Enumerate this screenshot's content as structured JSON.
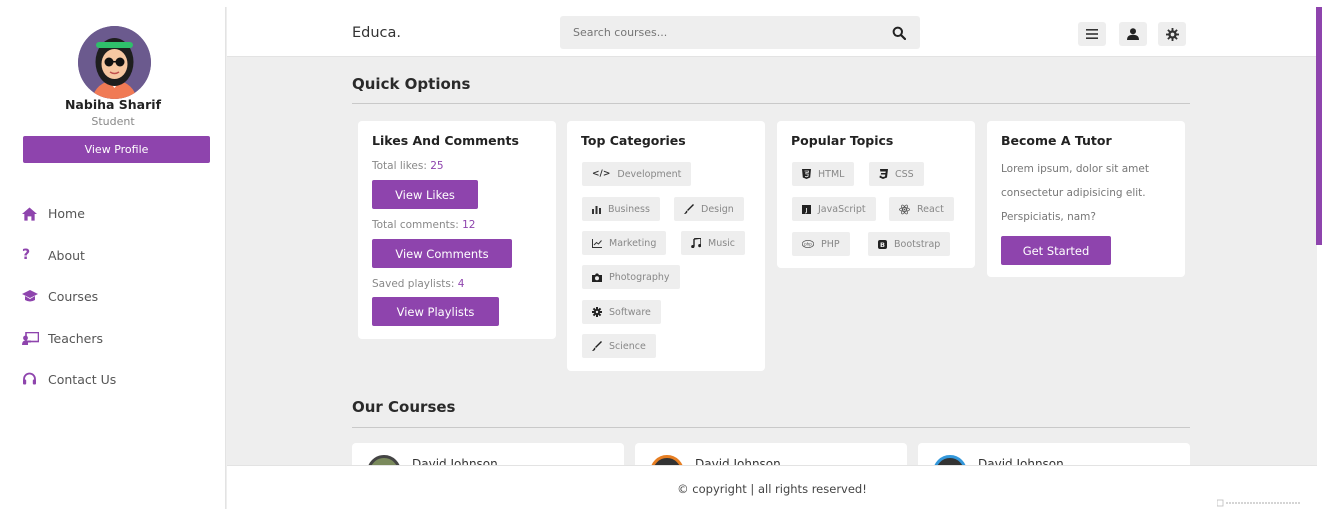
{
  "sidebar": {
    "user_name": "Nabiha Sharif",
    "user_role": "Student",
    "profile_button": "View Profile",
    "nav": [
      {
        "label": "Home",
        "icon": "home-icon"
      },
      {
        "label": "About",
        "icon": "question-icon"
      },
      {
        "label": "Courses",
        "icon": "graduation-cap-icon"
      },
      {
        "label": "Teachers",
        "icon": "chalkboard-teacher-icon"
      },
      {
        "label": "Contact Us",
        "icon": "headset-icon"
      }
    ]
  },
  "header": {
    "logo": "Educa.",
    "search_placeholder": "Search courses...",
    "icons": [
      "menu-icon",
      "user-icon",
      "settings-gear-icon"
    ]
  },
  "quick_options": {
    "title": "Quick Options",
    "likes_card": {
      "title": "Likes And Comments",
      "likes_label": "Total likes: ",
      "likes_value": "25",
      "likes_button": "View Likes",
      "comments_label": "Total comments: ",
      "comments_value": "12",
      "comments_button": "View Comments",
      "playlists_label": "Saved playlists: ",
      "playlists_value": "4",
      "playlists_button": "View Playlists"
    },
    "categories_card": {
      "title": "Top Categories",
      "tags": [
        "Development",
        "Business",
        "Design",
        "Marketing",
        "Music",
        "Photography",
        "Software",
        "Science"
      ]
    },
    "topics_card": {
      "title": "Popular Topics",
      "tags": [
        "HTML",
        "CSS",
        "JavaScript",
        "React",
        "PHP",
        "Bootstrap"
      ]
    },
    "tutor_card": {
      "title": "Become A Tutor",
      "text": "Lorem ipsum, dolor sit amet consectetur adipisicing elit. Perspiciatis, nam?",
      "button": "Get Started"
    }
  },
  "courses": {
    "title": "Our Courses",
    "items": [
      {
        "teacher": "David Johnson"
      },
      {
        "teacher": "David Johnson"
      },
      {
        "teacher": "David Johnson"
      }
    ]
  },
  "footer": {
    "text": "© copyright | all rights reserved!"
  },
  "colors": {
    "accent": "#8e44ad",
    "background": "#eeeeee",
    "card": "#ffffff"
  }
}
